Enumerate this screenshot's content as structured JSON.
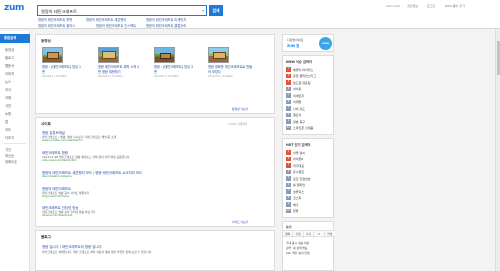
{
  "header": {
    "logo": "zum",
    "search": {
      "value": "명량의 태민크래프트",
      "button": "검색"
    },
    "suggestions": [
      "명량의 태민크래프트 활활",
      "명량의 태민크래프트 세븐펜리",
      "명량의 태민크래프트 미세먼지",
      "명량의 태민크래프트 플러스",
      "명량의 태민크래프트 인스펙트",
      "명량의 태민크래프트 클럽홀릭",
      "명량의 태민크래프트 공포",
      "명량의 태민크래프트 대왕대왕"
    ],
    "utility": [
      "zum.com",
      "개인정보",
      "로그인",
      "ZUM 툴바 추가"
    ]
  },
  "sidebar": {
    "active": "통합검색",
    "items": [
      "동영상",
      "블로그",
      "웹문서",
      "이미지",
      "뉴스",
      "지식",
      "카페",
      "사전",
      "쇼핑",
      "앱",
      "지도",
      "더보기"
    ],
    "filters": [
      "기간",
      "최신순",
      "정확도순"
    ]
  },
  "video": {
    "title": "동영상",
    "items": [
      {
        "title": "명량 : [태민크래프트] 영상 1편",
        "meta": "2014.8.1 | YouTube",
        "views": "조회수 2,451",
        "duration": "6:21"
      },
      {
        "title": "명량 태민크래프트 제작 시작 2편 명량 재현하기",
        "meta": "2014.8.2 | YouTube",
        "views": "조회수 1,985",
        "duration": "8:48"
      },
      {
        "title": "명량 : [태민크래프트] 영상 3편",
        "meta": "2014.8.3 | YouTube",
        "views": "조회수 1,632",
        "duration": "7:10"
      },
      {
        "title": "명량 영화를 마인크래프트로 만들어 보았다",
        "meta": "2014.8.5 | YouTube",
        "views": "조회수 3,210",
        "duration": "9:52"
      }
    ],
    "more": "동영상 더보기"
  },
  "web": {
    "title": "사이트",
    "note": "1/100 검색결과",
    "items": [
      {
        "title": "명량 유튜브채널",
        "desc": "마인크래프트 / 명량, 영상 다시보기, 태민크래프트 채널 등 소개",
        "url": "www.youtube.com/user/taemin"
      },
      {
        "title": "태민크래프트 명량",
        "desc": "2014.11.28 태민크래프트 명량 에피소드 전체 정리 관련 영상 모음입니다.",
        "url": "cafe.naver.com/taeminbot"
      },
      {
        "title": "명량의 태민크래프트 세븐펜리 모드 / 명량 태민크래프트 쇼크처리 모드",
        "desc": "",
        "url": "bbs.ruliweb.com/game"
      },
      {
        "title": "명량의 태민크래프트",
        "desc": "태민크래프트 명량 공식 사이트 방문하기",
        "url": "blog.naver.com/hoon"
      },
      {
        "title": "태민크래프트 인터넷 방송",
        "desc": "태민크래프트 명량 공식 인터넷 방송 바로가기",
        "url": "afreeca.com/taeminbot"
      }
    ],
    "more": "사이트 더보기"
  },
  "blog": {
    "title": "블로그",
    "item": {
      "title": "명량 입니다 / 태민크래프트의 명량 입니다",
      "desc": "마인크래프트 세계입니다. 태민 크래프트 제작 과정과 명량 재현 작업을 함께 보실 수 있습니다."
    }
  },
  "right": {
    "promo": {
      "line1": "다운받아봐요",
      "line2": "ZUM 앱",
      "icon_label": "zum"
    },
    "realtime": {
      "title": "NOW 이슈 검색어",
      "items": [
        "에볼라 바이러스",
        "유럽 챔피언스리그",
        "월드컵 대표팀",
        "아이유",
        "미세먼지",
        "이재명",
        "나비 귀도",
        "결혼식",
        "일본 축구",
        "스마트폰 신제품"
      ]
    },
    "hot": {
      "title": "HOT 인기 검색어",
      "items": [
        "서울 날씨",
        "아이폰6",
        "국가대표",
        "유니클로",
        "로또 당첨번호",
        "롤 챔피언",
        "넷플릭스",
        "코스피",
        "배구",
        "환율"
      ]
    },
    "news": {
      "title": "뉴스",
      "tabs": [
        "정치",
        "경제",
        "사회",
        "IT",
        "연예"
      ],
      "items": [
        "국내 증시 상승 마감",
        "정부, 새 정책 발표",
        "KIA, 역전 승리 달성"
      ]
    }
  },
  "colors": {
    "accent": "#1d7ad9",
    "link": "#1a3fa8",
    "rank_top": "#e8503a",
    "rank_rest": "#8a9bb3"
  }
}
